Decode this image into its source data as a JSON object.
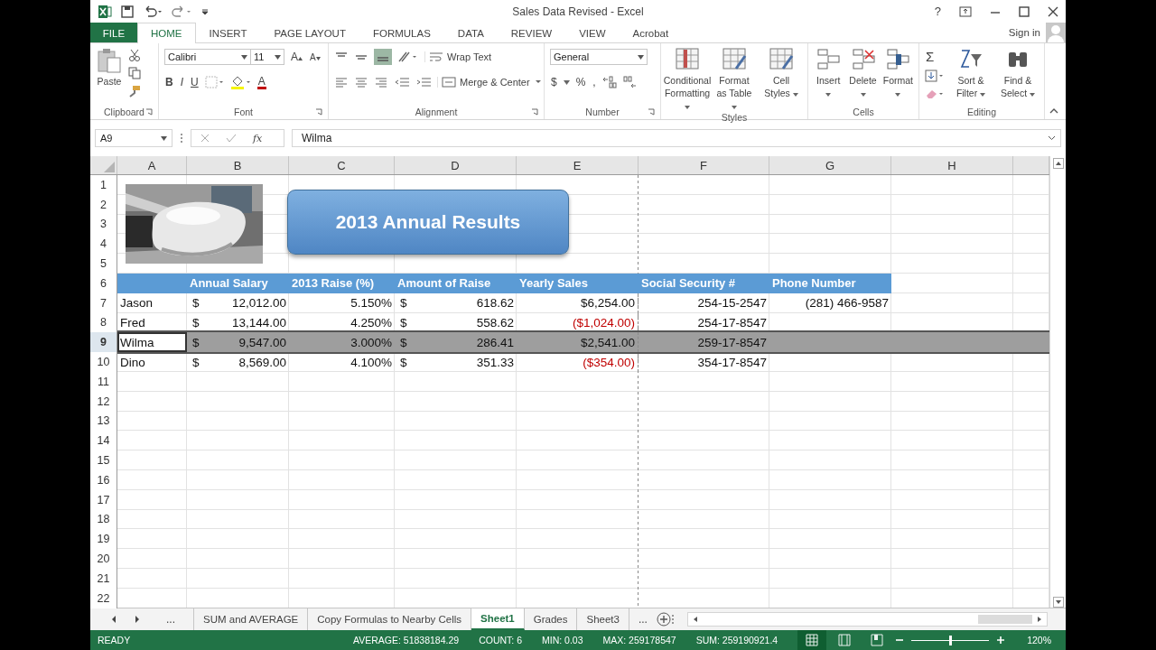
{
  "window": {
    "title": "Sales Data Revised - Excel",
    "help": "?"
  },
  "ribbon_tabs": [
    {
      "label": "FILE",
      "kind": "file",
      "selected": false
    },
    {
      "label": "HOME",
      "kind": "tab",
      "selected": true
    },
    {
      "label": "INSERT",
      "kind": "tab",
      "selected": false
    },
    {
      "label": "PAGE LAYOUT",
      "kind": "tab",
      "selected": false
    },
    {
      "label": "FORMULAS",
      "kind": "tab",
      "selected": false
    },
    {
      "label": "DATA",
      "kind": "tab",
      "selected": false
    },
    {
      "label": "REVIEW",
      "kind": "tab",
      "selected": false
    },
    {
      "label": "VIEW",
      "kind": "tab",
      "selected": false
    },
    {
      "label": "Acrobat",
      "kind": "tab",
      "selected": false
    }
  ],
  "account": {
    "label": "Sign in"
  },
  "ribbon": {
    "groups": [
      {
        "kind": "clipboard",
        "label": "Clipboard",
        "paste": "Paste"
      },
      {
        "kind": "font",
        "label": "Font",
        "font_name": "Calibri",
        "font_size": "11",
        "grow": "A",
        "shrink": "A",
        "bold": "B",
        "italic": "I",
        "underline": "U",
        "font_color": "A"
      },
      {
        "kind": "alignment",
        "label": "Alignment",
        "wrap": "Wrap Text",
        "merge": "Merge & Center"
      },
      {
        "kind": "number",
        "label": "Number",
        "format": "General",
        "currency": "$",
        "percent": "%",
        "comma": ","
      },
      {
        "kind": "styles",
        "label": "Styles",
        "buttons": [
          "Conditional Formatting",
          "Format as Table",
          "Cell Styles"
        ]
      },
      {
        "kind": "cells",
        "label": "Cells",
        "buttons": [
          "Insert",
          "Delete",
          "Format"
        ]
      },
      {
        "kind": "editing",
        "label": "Editing",
        "sum": "Σ",
        "buttons": [
          "Sort & Filter",
          "Find & Select"
        ]
      }
    ]
  },
  "name_box": "A9",
  "formula_bar": {
    "fx": "fx",
    "value": "Wilma"
  },
  "columns": [
    "A",
    "B",
    "C",
    "D",
    "E",
    "F",
    "G",
    "H"
  ],
  "shape": {
    "text": "2013 Annual Results"
  },
  "rows": [
    {
      "number": "1",
      "selected": false
    },
    {
      "number": "2",
      "selected": false
    },
    {
      "number": "3",
      "selected": false
    },
    {
      "number": "4",
      "selected": false
    },
    {
      "number": "5",
      "selected": false
    },
    {
      "number": "6",
      "selected": false,
      "kind": "header",
      "cells": [
        {},
        {
          "text": "Annual Salary"
        },
        {
          "text": "2013 Raise (%)"
        },
        {
          "text": "Amount of Raise"
        },
        {
          "text": "Yearly Sales"
        },
        {
          "text": "Social Security #"
        },
        {
          "text": "Phone Number"
        }
      ]
    },
    {
      "number": "7",
      "selected": false,
      "kind": "data",
      "cells": [
        {
          "text": "Jason",
          "active": false
        },
        {
          "currency": "$",
          "text": "12,012.00"
        },
        {
          "text": "5.150%"
        },
        {
          "currency": "$",
          "text": "618.62"
        },
        {
          "text": "$6,254.00",
          "negative": false
        },
        {
          "text": "254-15-2547"
        },
        {
          "text": "(281) 466-9587"
        }
      ]
    },
    {
      "number": "8",
      "selected": false,
      "kind": "data",
      "cells": [
        {
          "text": "Fred",
          "active": false
        },
        {
          "currency": "$",
          "text": "13,144.00"
        },
        {
          "text": "4.250%"
        },
        {
          "currency": "$",
          "text": "558.62"
        },
        {
          "text": "($1,024.00)",
          "negative": true
        },
        {
          "text": "254-17-8547"
        }
      ]
    },
    {
      "number": "9",
      "selected": true,
      "kind": "data",
      "cells": [
        {
          "text": "Wilma",
          "active": true
        },
        {
          "currency": "$",
          "text": "9,547.00"
        },
        {
          "text": "3.000%"
        },
        {
          "currency": "$",
          "text": "286.41"
        },
        {
          "text": "$2,541.00",
          "negative": false
        },
        {
          "text": "259-17-8547"
        }
      ]
    },
    {
      "number": "10",
      "selected": false,
      "kind": "data",
      "cells": [
        {
          "text": "Dino",
          "active": false
        },
        {
          "currency": "$",
          "text": "8,569.00"
        },
        {
          "text": "4.100%"
        },
        {
          "currency": "$",
          "text": "351.33"
        },
        {
          "text": "($354.00)",
          "negative": true
        },
        {
          "text": "354-17-8547"
        }
      ]
    },
    {
      "number": "11",
      "selected": false
    },
    {
      "number": "12",
      "selected": false
    },
    {
      "number": "13",
      "selected": false
    },
    {
      "number": "14",
      "selected": false
    },
    {
      "number": "15",
      "selected": false
    },
    {
      "number": "16",
      "selected": false
    },
    {
      "number": "17",
      "selected": false
    },
    {
      "number": "18",
      "selected": false
    },
    {
      "number": "19",
      "selected": false
    },
    {
      "number": "20",
      "selected": false
    },
    {
      "number": "21",
      "selected": false
    },
    {
      "number": "22",
      "selected": false
    }
  ],
  "sheet_tabs": [
    {
      "label": "SUM and AVERAGE",
      "selected": false
    },
    {
      "label": "Copy Formulas to Nearby Cells",
      "selected": false
    },
    {
      "label": "Sheet1",
      "selected": true
    },
    {
      "label": "Grades",
      "selected": false
    },
    {
      "label": "Sheet3",
      "selected": false
    }
  ],
  "sheet_nav": {
    "more_left": "...",
    "more_right": "..."
  },
  "status_bar": {
    "mode": "READY",
    "stats": [
      "AVERAGE: 51838184.29",
      "COUNT: 6",
      "MIN: 0.03",
      "MAX: 259178547",
      "SUM: 259190921.4"
    ],
    "views": [
      {
        "kind": "normal",
        "selected": true
      },
      {
        "kind": "page-layout",
        "selected": false
      },
      {
        "kind": "page-break",
        "selected": false
      }
    ],
    "zoom": {
      "level": 0.5,
      "label": "120%"
    }
  }
}
